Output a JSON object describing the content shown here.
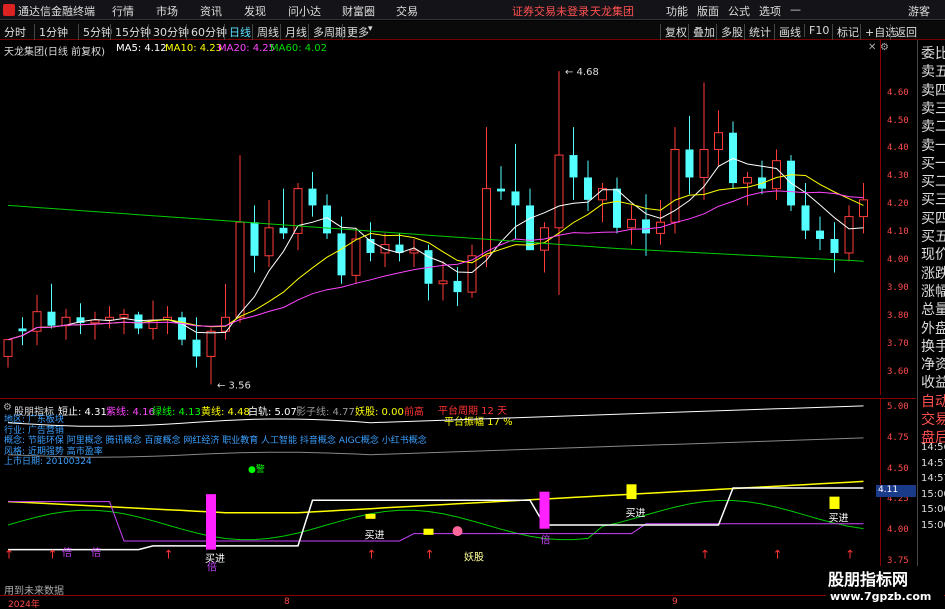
{
  "menubar": {
    "app_title": "通达信金融终端",
    "menus": [
      "行情",
      "市场",
      "资讯",
      "发现",
      "问小达",
      "财富圈",
      "交易"
    ],
    "notice": "证券交易未登录",
    "stock_name": "天龙集团",
    "right_menus": [
      "功能",
      "版面",
      "公式",
      "选项"
    ],
    "user": "游客",
    "window_controls": [
      "minimize-icon",
      "maximize-icon",
      "close-icon"
    ]
  },
  "toolbar": {
    "periods": [
      "分时",
      "1分钟",
      "5分钟",
      "15分钟",
      "30分钟",
      "60分钟",
      "日线",
      "周线",
      "月线",
      "多周期",
      "更多"
    ],
    "active_period": "日线",
    "right_buttons": [
      "复权",
      "叠加",
      "多股",
      "统计",
      "画线",
      "F10",
      "标记",
      "+自选",
      "返回"
    ]
  },
  "main_chart": {
    "title": "天龙集团(日线 前复权)",
    "ma": [
      {
        "label": "MA5: 4.12",
        "color": "#ffffff"
      },
      {
        "label": "MA10: 4.23",
        "color": "#ffff00"
      },
      {
        "label": "MA20: 4.25",
        "color": "#ff00ff"
      },
      {
        "label": "MA60: 4.02",
        "color": "#00cc00"
      }
    ],
    "y_ticks": [
      "4.60",
      "4.50",
      "4.40",
      "4.30",
      "4.20",
      "4.10",
      "4.00",
      "3.90",
      "3.80",
      "3.70",
      "3.60"
    ],
    "high_label": "4.68",
    "low_label": "3.56"
  },
  "indicator": {
    "name": "股朋指标",
    "values": [
      {
        "label": "短止: 4.31",
        "color": "#ffffff"
      },
      {
        "label": "紫线: 4.16",
        "color": "#ff44ff"
      },
      {
        "label": "绿线: 4.13",
        "color": "#00ff00"
      },
      {
        "label": "黄线: 4.48",
        "color": "#ffff00"
      },
      {
        "label": "白轨: 5.07",
        "color": "#ffffff"
      },
      {
        "label": "影子线: 4.77",
        "color": "#888888"
      },
      {
        "label": "妖股: 0.00",
        "color": "#ffff00"
      },
      {
        "label": "前高",
        "color": "#ff3333"
      }
    ],
    "info_lines": [
      "地区:   广东板块",
      "行业:   广告营销",
      "概念:   节能环保 阿里概念 腾讯概念 百度概念 网红经济 职业教育 人工智能 抖音概念 AIGC概念 小红书概念",
      "风格:   近期强势 高市盈率",
      "上市日期: 20100324"
    ],
    "platform_period": "平台周期 12 天",
    "platform_amplitude": "平台振幅 17 %",
    "y_ticks": [
      "5.00",
      "4.75",
      "4.50",
      "4.25",
      "4.00",
      "3.75"
    ],
    "current_value": "4.11",
    "signals": {
      "buy": "买进",
      "demon": "妖股",
      "double": "倍",
      "warn": "警"
    },
    "footer": "用到未来数据"
  },
  "x_axis": {
    "labels": [
      "2024年",
      "8",
      "9"
    ]
  },
  "right_panel": {
    "items": [
      "委比",
      "卖五",
      "卖四",
      "卖三",
      "卖二",
      "卖一",
      "买一",
      "买二",
      "买三",
      "买四",
      "买五",
      "现价",
      "涨跌",
      "涨幅",
      "总量",
      "外盘",
      "换手",
      "净资",
      "收益",
      "自动",
      "交易",
      "盘后"
    ],
    "times": [
      "14:56",
      "14:57",
      "14:57",
      "15:00",
      "15:00",
      "15:00"
    ]
  },
  "watermark": {
    "line1": "股朋指标网",
    "line2": "www.7gpzb.com"
  },
  "chart_data": {
    "type": "candlestick",
    "dates_note": "",
    "ohlc": [
      [
        3.66,
        3.72,
        3.62,
        3.72
      ],
      [
        3.76,
        3.8,
        3.7,
        3.75
      ],
      [
        3.75,
        3.88,
        3.7,
        3.82
      ],
      [
        3.82,
        3.92,
        3.76,
        3.77
      ],
      [
        3.77,
        3.83,
        3.72,
        3.8
      ],
      [
        3.8,
        3.85,
        3.74,
        3.78
      ],
      [
        3.78,
        3.82,
        3.72,
        3.79
      ],
      [
        3.79,
        3.84,
        3.76,
        3.8
      ],
      [
        3.8,
        3.83,
        3.74,
        3.81
      ],
      [
        3.81,
        3.82,
        3.74,
        3.76
      ],
      [
        3.76,
        3.86,
        3.72,
        3.79
      ],
      [
        3.79,
        3.84,
        3.74,
        3.8
      ],
      [
        3.8,
        3.82,
        3.7,
        3.72
      ],
      [
        3.72,
        3.8,
        3.62,
        3.66
      ],
      [
        3.66,
        3.76,
        3.56,
        3.75
      ],
      [
        3.75,
        3.92,
        3.72,
        3.8
      ],
      [
        3.8,
        4.38,
        3.78,
        4.14
      ],
      [
        4.14,
        4.2,
        3.96,
        4.02
      ],
      [
        4.02,
        4.22,
        3.98,
        4.12
      ],
      [
        4.12,
        4.26,
        4.08,
        4.1
      ],
      [
        4.1,
        4.28,
        4.04,
        4.26
      ],
      [
        4.26,
        4.32,
        4.16,
        4.2
      ],
      [
        4.2,
        4.24,
        4.08,
        4.1
      ],
      [
        4.1,
        4.16,
        3.92,
        3.95
      ],
      [
        3.95,
        4.12,
        3.92,
        4.08
      ],
      [
        4.08,
        4.14,
        4.0,
        4.03
      ],
      [
        4.03,
        4.1,
        3.98,
        4.06
      ],
      [
        4.06,
        4.1,
        4.0,
        4.03
      ],
      [
        4.03,
        4.08,
        3.98,
        4.04
      ],
      [
        4.04,
        4.06,
        3.86,
        3.92
      ],
      [
        3.92,
        4.0,
        3.86,
        3.93
      ],
      [
        3.93,
        3.98,
        3.84,
        3.89
      ],
      [
        3.89,
        4.06,
        3.87,
        4.02
      ],
      [
        4.02,
        4.48,
        3.98,
        4.26
      ],
      [
        4.26,
        4.34,
        4.22,
        4.25
      ],
      [
        4.25,
        4.42,
        4.08,
        4.2
      ],
      [
        4.2,
        4.26,
        4.04,
        4.04
      ],
      [
        4.04,
        4.14,
        3.96,
        4.12
      ],
      [
        4.12,
        4.68,
        3.88,
        4.38
      ],
      [
        4.38,
        4.48,
        4.22,
        4.3
      ],
      [
        4.3,
        4.36,
        4.18,
        4.22
      ],
      [
        4.22,
        4.28,
        4.14,
        4.26
      ],
      [
        4.26,
        4.3,
        4.1,
        4.12
      ],
      [
        4.12,
        4.2,
        4.06,
        4.15
      ],
      [
        4.15,
        4.24,
        4.02,
        4.1
      ],
      [
        4.1,
        4.22,
        4.06,
        4.14
      ],
      [
        4.14,
        4.48,
        4.1,
        4.4
      ],
      [
        4.4,
        4.52,
        4.24,
        4.3
      ],
      [
        4.3,
        4.64,
        4.22,
        4.4
      ],
      [
        4.4,
        4.54,
        4.34,
        4.46
      ],
      [
        4.46,
        4.5,
        4.26,
        4.28
      ],
      [
        4.28,
        4.32,
        4.2,
        4.3
      ],
      [
        4.3,
        4.36,
        4.24,
        4.26
      ],
      [
        4.26,
        4.4,
        4.22,
        4.36
      ],
      [
        4.36,
        4.38,
        4.18,
        4.2
      ],
      [
        4.2,
        4.28,
        4.08,
        4.11
      ],
      [
        4.11,
        4.16,
        4.04,
        4.08
      ],
      [
        4.08,
        4.14,
        3.96,
        4.03
      ],
      [
        4.03,
        4.2,
        4.0,
        4.16
      ],
      [
        4.16,
        4.28,
        4.1,
        4.22
      ]
    ],
    "ylim": [
      3.54,
      4.72
    ],
    "legend": [
      "MA5",
      "MA10",
      "MA20",
      "MA60"
    ]
  }
}
